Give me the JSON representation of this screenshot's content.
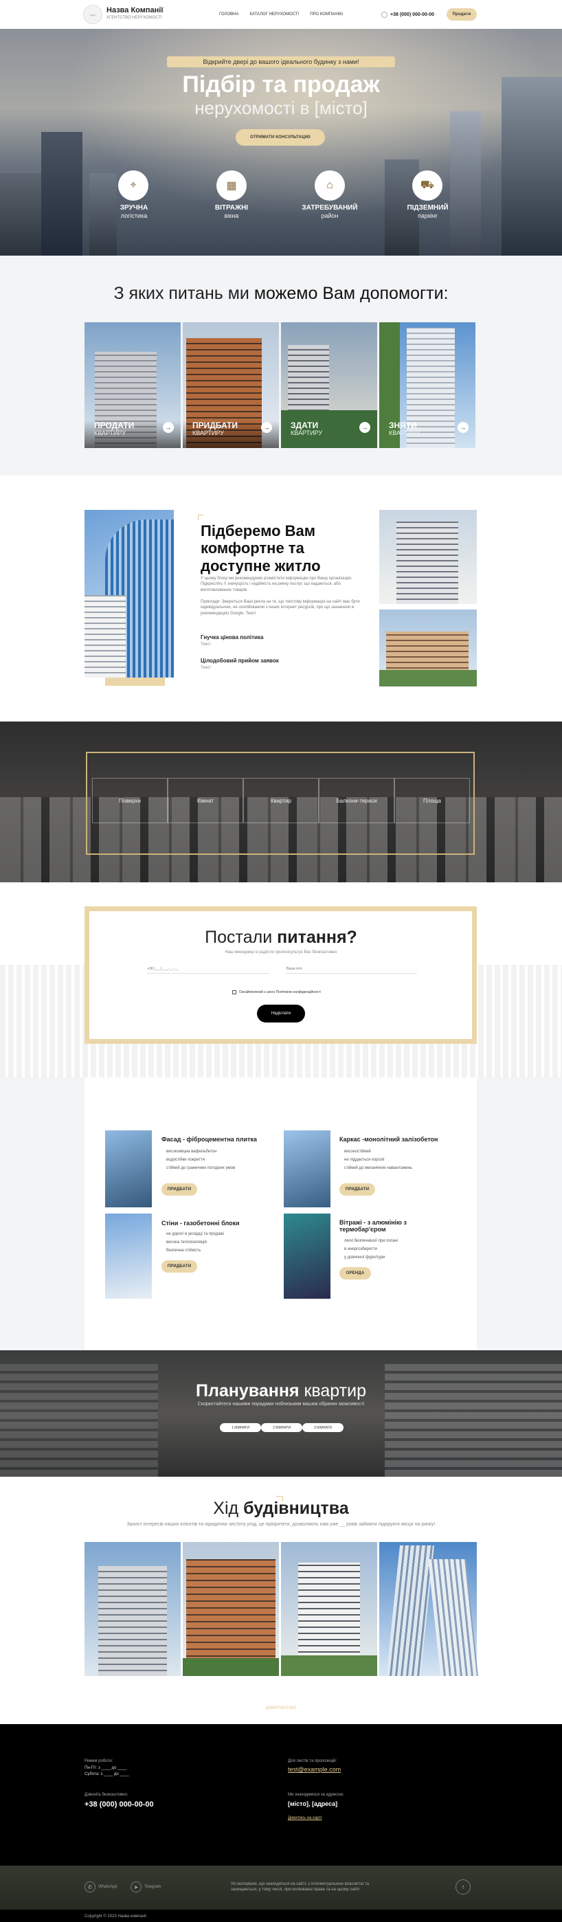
{
  "header": {
    "company_name": "Назва Компанії",
    "company_tagline": "АГЕНТСТВО НЕРУХОМОСТІ",
    "logo_text": "logo",
    "nav": [
      "ГОЛОВНА",
      "КАТАЛОГ НЕРУХОМОСТІ",
      "ПРО КОМПАНІЮ"
    ],
    "phone": "+38 (000) 000-00-00",
    "cta": "Продати"
  },
  "hero": {
    "kicker": "Відкрийте двері до вашого ідеального будинку з нами!",
    "title": "Підбір та продаж",
    "subtitle": "нерухомості в [місто]",
    "cta": "ОТРИМАТИ КОНСУЛЬТАЦІЮ",
    "features": [
      {
        "title": "ЗРУЧНА",
        "sub": "логістика",
        "icon": "map-pin-icon"
      },
      {
        "title": "ВІТРАЖНІ",
        "sub": "вікна",
        "icon": "window-icon"
      },
      {
        "title": "ЗАТРЕБУВАНИЙ",
        "sub": "район",
        "icon": "home-icon"
      },
      {
        "title": "ПІДЗЕМНИЙ",
        "sub": "паркінг",
        "icon": "car-icon"
      }
    ]
  },
  "help": {
    "title_plain": "З яких питань ми",
    "title_bold": "можемо Вам допомогти:",
    "cards": [
      {
        "title": "ПРОДАТИ",
        "sub": "КВАРТИРУ"
      },
      {
        "title": "ПРИДБАТИ",
        "sub": "КВАРТИРУ"
      },
      {
        "title": "ЗДАТИ",
        "sub": "КВАРТИРУ"
      },
      {
        "title": "ЗНЯТИ",
        "sub": "КВАРТИРУ"
      }
    ]
  },
  "about": {
    "title": "Підберемо Вам комфортне та доступне житло",
    "p1": "У цьому блоці ми рекомендуємо розмістити інформацію про Вашу організацію. Підкресліть її значущість і надійність на ринку послуг, що надаються, або виготовлюваних товарів.",
    "p2": "Приклади: Зверніться Ваші рекла на те, що текстову інформацію на сайті має бути індивідуальною, не скопійованою з інших інтернет ресурсів, про що зазначено в рекомендаціях Google. Текст",
    "items": [
      {
        "title": "Гнучка цінова політика",
        "text": "Текст"
      },
      {
        "title": "Цілодобовий прийом заявок",
        "text": "Текст"
      }
    ]
  },
  "stats": {
    "items": [
      "Поверхи",
      "Кімнат",
      "Квартир",
      "Балкони-тераси",
      "Площа"
    ]
  },
  "form": {
    "title_plain": "Постали",
    "title_bold": "питання?",
    "subtitle": "Наш менеджер із радістю проконсультує Вас безкоштовно",
    "name_placeholder": "Ім'я",
    "phone_placeholder": "+38 (___) ___-__-__",
    "message_placeholder": "Ваше ім'я",
    "consent": "Ознайомлений з users Політикою конфіденційності",
    "submit": "Надіслати"
  },
  "products": [
    {
      "title": "Фасад - фіброцементна плитка",
      "lines": [
        "високоміцна вафельбетон",
        "водостійке покриття",
        "стійкий до граничних погодних умов"
      ],
      "cta": "ПРИДБАТИ"
    },
    {
      "title": "Каркас -монолітний залізобетон",
      "lines": [
        "високостійкий",
        "не піддається корозії",
        "стійкий до механічних навантажень"
      ],
      "cta": "ПРИДБАТИ"
    },
    {
      "title": "Стіни - газобетонні блоки",
      "lines": [
        "не дорогі в укладці та продажі",
        "висока теплоізоляція",
        "безпечна стійкість"
      ],
      "cta": "ПРИДБАТИ"
    },
    {
      "title": "Вітражі - з алюмінію з термобар'єром",
      "lines": [
        "легкі безпечнішої при погані",
        "в енергозберегти",
        "у довичної фурнітури"
      ],
      "cta": "ОРЕНДА"
    }
  ],
  "planning": {
    "title_plain": "Планування",
    "title_bold": "квартир",
    "subtitle": "Скористайтеся нашими порадами поблизьким вашим обраних можливості",
    "chips": [
      "1 КІМНАТИ",
      "2 КІМНАТИ",
      "3 КІМНАТИ"
    ]
  },
  "progress": {
    "title_plain": "Хід",
    "title_bold": "будівництва",
    "subtitle": "Захист інтересів наших клієнтів та юридична чистота угод, це пріоритети, дозволяють нам уже __ років займати лідируючі місця на ринку!",
    "more": "ДИВИТИСЯ ВСІ"
  },
  "footer": {
    "hours_label": "Режим роботи:",
    "hours_1": "Пн-Пт: з ____ до ____",
    "hours_2": "Субота: з ____ до ____",
    "email_label": "Для листів та пропозицій:",
    "email": "test@example.com",
    "phone_label": "Дзвоніть безкоштовно:",
    "phone": "+38 (000) 000-00-00",
    "address_label": "Ми знаходимося за адресою:",
    "address": "[місто], [адреса]",
    "map_link": "Дивитись на карті",
    "whatsapp": "WhatsApp",
    "telegram": "Telegram",
    "disclaimer": "Усі матеріали, що знаходяться на сайті, є інтелектуальною власністю та захищаються, у тому числі, при копіюванні права та на цьому сайті",
    "copyright": "Copyright © 2023 Назва компанії"
  },
  "colors": {
    "accent": "#ead6a8",
    "dark": "#111111"
  }
}
